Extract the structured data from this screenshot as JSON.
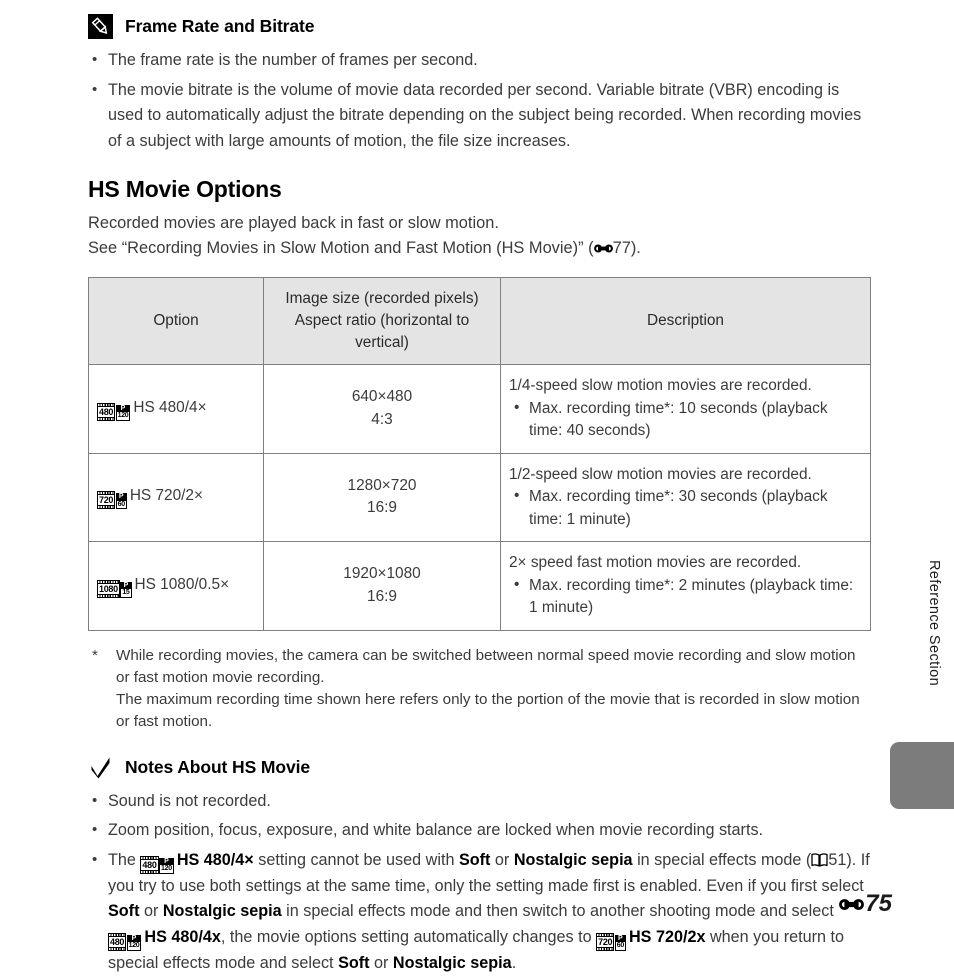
{
  "note_frame_rate": {
    "icon": "pencil-icon",
    "title": "Frame Rate and Bitrate",
    "bullets": [
      "The frame rate is the number of frames per second.",
      "The movie bitrate is the volume of movie data recorded per second. Variable bitrate (VBR) encoding is used to automatically adjust the bitrate depending on the subject being recorded. When recording movies of a subject with large amounts of motion, the file size increases."
    ]
  },
  "section": {
    "title": "HS Movie Options",
    "line1": "Recorded movies are played back in fast or slow motion.",
    "line2_before": "See “Recording Movies in Slow Motion and Fast Motion (HS Movie)” (",
    "line2_ref_icon": "reference-section-icon",
    "line2_ref": "77",
    "line2_after": ")."
  },
  "table": {
    "headers": {
      "option": "Option",
      "image_size": "Image size (recorded pixels)\nAspect ratio (horizontal to vertical)",
      "image_size_line1": "Image size (recorded pixels)",
      "image_size_line2": "Aspect ratio (horizontal to vertical)",
      "description": "Description"
    },
    "rows": [
      {
        "icon_res": "480",
        "icon_mode": "P",
        "icon_fps": "120",
        "option": "HS 480/4×",
        "size": "640×480",
        "ratio": "4:3",
        "desc_lead": "1/4-speed slow motion movies are recorded.",
        "desc_bullets": [
          "Max. recording time*: 10 seconds (playback time: 40 seconds)"
        ]
      },
      {
        "icon_res": "720",
        "icon_mode": "P",
        "icon_fps": "60",
        "option": "HS 720/2×",
        "size": "1280×720",
        "ratio": "16:9",
        "desc_lead": "1/2-speed slow motion movies are recorded.",
        "desc_bullets": [
          "Max. recording time*: 30 seconds (playback time: 1 minute)"
        ]
      },
      {
        "icon_res": "1080",
        "icon_mode": "P",
        "icon_fps": "15",
        "option": "HS 1080/0.5×",
        "size": "1920×1080",
        "ratio": "16:9",
        "desc_lead": "2× speed fast motion movies are recorded.",
        "desc_bullets": [
          "Max. recording time*: 2 minutes (playback time: 1 minute)"
        ]
      }
    ]
  },
  "footnote": {
    "marker": "*",
    "line1": "While recording movies, the camera can be switched between normal speed movie recording and slow motion or fast motion movie recording.",
    "line2": "The maximum recording time shown here refers only to the portion of the movie that is recorded in slow motion or fast motion."
  },
  "note_hs_movie": {
    "icon": "check-icon",
    "title": "Notes About HS Movie",
    "bullet1": "Sound is not recorded.",
    "bullet2": "Zoom position, focus, exposure, and white balance are locked when movie recording starts.",
    "bullet3": {
      "p1": "The ",
      "icon1_res": "480",
      "icon1_mode": "P",
      "icon1_fps": "120",
      "b1": "HS 480/4×",
      "p2": " setting cannot be used with ",
      "b2": "Soft",
      "p3": " or ",
      "b3": "Nostalgic sepia",
      "p4": " in special effects mode (",
      "book_icon": "book-icon",
      "page_ref": "51",
      "p5": "). If you try to use both settings at the same time, only the setting made first is enabled. Even if you first select ",
      "b4": "Soft",
      "p6": " or ",
      "b5": "Nostalgic sepia",
      "p7": " in special effects mode and then switch to another shooting mode and select ",
      "icon2_res": "480",
      "icon2_mode": "P",
      "icon2_fps": "120",
      "b6": "HS 480/4x",
      "p8": ", the movie options setting automatically changes to ",
      "icon3_res": "720",
      "icon3_mode": "P",
      "icon3_fps": "60",
      "b7": "HS 720/2x",
      "p9": " when you return to special effects mode and select ",
      "b8": "Soft",
      "p10": " or ",
      "b9": "Nostalgic sepia",
      "p11": "."
    }
  },
  "side": {
    "label": "Reference Section"
  },
  "page_number": {
    "icon": "reference-section-icon",
    "number": "75"
  },
  "colors": {
    "table_header_bg": "#e4e4e4",
    "table_border": "#808080",
    "side_tab": "#7c7c7c",
    "body_text": "#3b3b3b",
    "heading_text": "#000000"
  }
}
